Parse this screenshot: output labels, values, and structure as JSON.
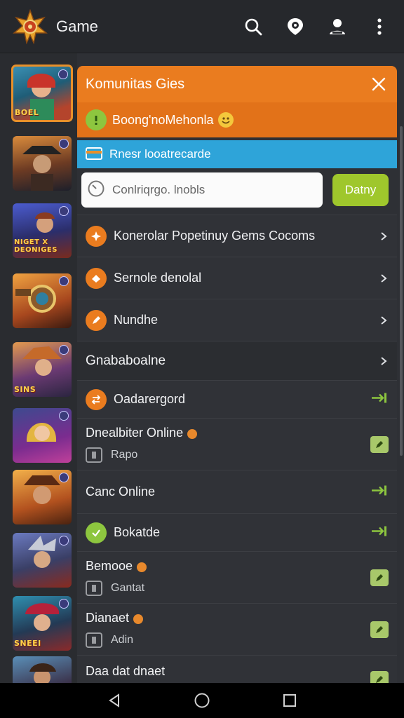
{
  "app": {
    "title": "Game"
  },
  "topbar": {
    "icons": [
      "search-icon",
      "location-icon",
      "account-icon",
      "more-vert-icon"
    ]
  },
  "rail": {
    "thumbnails": [
      {
        "caption": "BOEL",
        "icon": "game-thumbnail"
      },
      {
        "caption": "",
        "icon": "game-thumbnail"
      },
      {
        "caption": "NIGET X DEONIGES",
        "icon": "game-thumbnail"
      },
      {
        "caption": "",
        "icon": "game-thumbnail"
      },
      {
        "caption": "SINS",
        "icon": "game-thumbnail"
      },
      {
        "caption": "",
        "icon": "game-thumbnail"
      },
      {
        "caption": "",
        "icon": "game-thumbnail"
      },
      {
        "caption": "",
        "icon": "game-thumbnail"
      },
      {
        "caption": "SNEEI",
        "icon": "game-thumbnail"
      },
      {
        "caption": "",
        "icon": "game-thumbnail"
      }
    ]
  },
  "panel": {
    "title": "Komunitas Gies",
    "notice": "Boong'noMehonla",
    "info": "Rnesr looatrecarde",
    "search_placeholder": "Conlriqrgo. lnobls",
    "go_button": "Datny",
    "menu": [
      {
        "label": "Konerolar Popetinuy Gems Cocoms"
      },
      {
        "label": "Sernole denolal"
      },
      {
        "label": "Nundhe"
      }
    ],
    "section_title": "Gnababoalne",
    "list": [
      {
        "title": "Oadarergord",
        "sub": ""
      },
      {
        "title": "Dnealbiter Online",
        "sub": "Rapo"
      },
      {
        "title": "Canc Online",
        "sub": ""
      },
      {
        "title": "Bokatde",
        "sub": ""
      },
      {
        "title": "Bemooe",
        "sub": "Gantat"
      },
      {
        "title": "Dianaet",
        "sub": "Adin"
      },
      {
        "title": "Daa dat dnaet",
        "sub": ""
      }
    ]
  },
  "colors": {
    "accent": "#ea7c1f",
    "info": "#2ea4d9",
    "go": "#9fc72c",
    "bg": "#2e3035"
  },
  "navbar": {
    "icons": [
      "back-icon",
      "home-icon",
      "recents-icon"
    ]
  }
}
